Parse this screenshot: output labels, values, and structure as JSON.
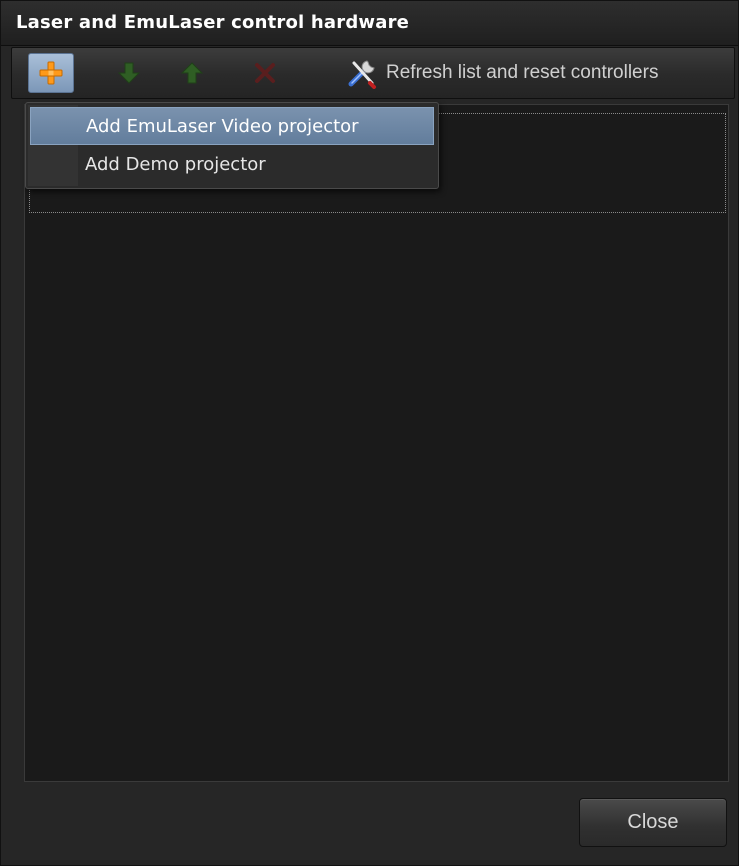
{
  "window": {
    "title": "Laser and EmuLaser control hardware"
  },
  "toolbar": {
    "add_icon": "plus-icon",
    "move_down_icon": "arrow-down-icon",
    "move_up_icon": "arrow-up-icon",
    "remove_icon": "x-icon",
    "refresh_icon": "tools-icon",
    "refresh_label": "Refresh list and reset controllers",
    "colors": {
      "add_orange": "#ff9a1a",
      "arrow_green": "#2f5e24",
      "remove_red": "#5a1e1e"
    }
  },
  "add_menu": {
    "items": [
      {
        "label": "Add EmuLaser Video projector",
        "highlighted": true
      },
      {
        "label": "Add Demo projector",
        "highlighted": false
      }
    ]
  },
  "footer": {
    "close_label": "Close"
  }
}
